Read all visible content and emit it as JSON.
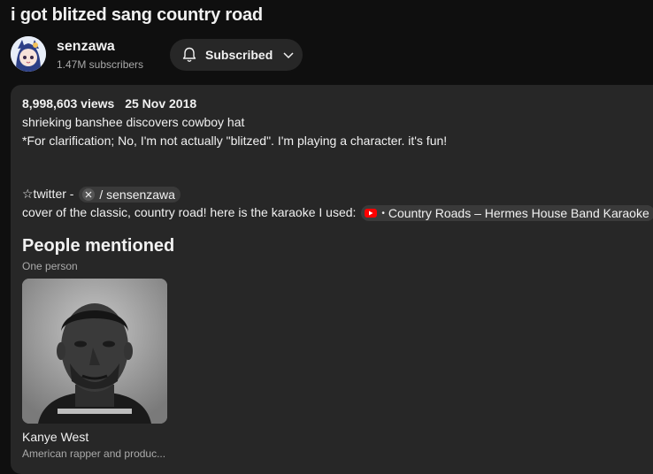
{
  "video": {
    "title": "i got blitzed sang country road"
  },
  "channel": {
    "name": "senzawa",
    "subscribers": "1.47M subscribers",
    "subscribe_label": "Subscribed",
    "bell_icon": "bell-icon",
    "chevron_icon": "chevron-down-icon"
  },
  "description": {
    "views": "8,998,603 views",
    "date": "25 Nov 2018",
    "line1": "shrieking banshee discovers cowboy hat",
    "line2": "*For clarification; No, I'm not actually \"blitzed\". I'm playing a character. it's fun!",
    "twitter_prefix": "☆twitter -",
    "twitter_handle": "/ sensenzawa",
    "cover_text": "cover of the classic, country road! here is the karaoke I used:",
    "karaoke_link": "Country Roads – Hermes House Band Karaoke",
    "karaoke_dot": "•"
  },
  "people": {
    "heading": "People mentioned",
    "count": "One person",
    "items": [
      {
        "name": "Kanye West",
        "desc": "American rapper and produc..."
      }
    ]
  },
  "colors": {
    "background": "#0f0f0f",
    "panel": "#272727",
    "text": "#f1f1f1",
    "secondary": "#aaaaaa",
    "youtube_red": "#ff0000"
  }
}
